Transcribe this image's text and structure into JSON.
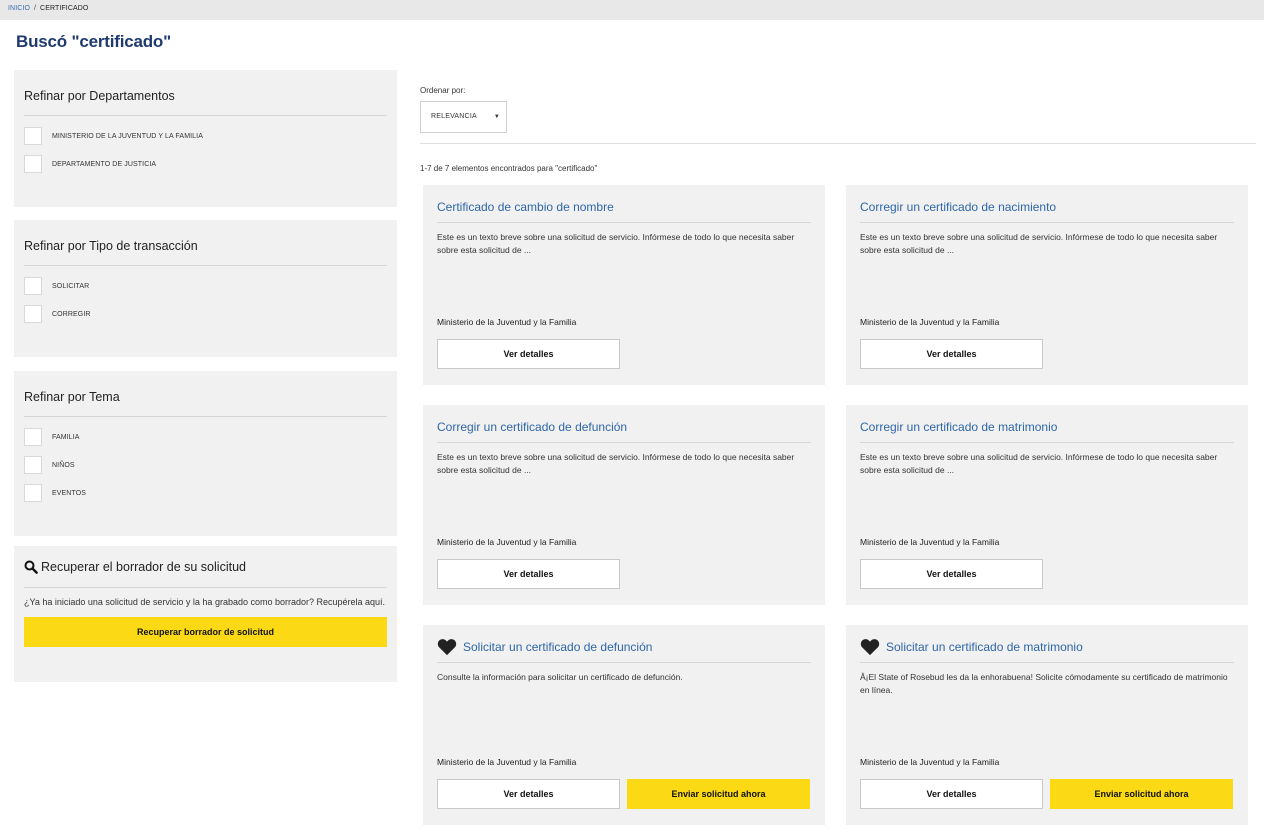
{
  "breadcrumb": {
    "home": "INICIO",
    "separator": "/",
    "current": "CERTIFICADO"
  },
  "page_title": "Buscó \"certificado\"",
  "filters": [
    {
      "title": "Refinar por Departamentos",
      "options": [
        "MINISTERIO DE LA JUVENTUD Y LA FAMILIA",
        "DEPARTAMENTO DE JUSTICIA"
      ]
    },
    {
      "title": "Refinar por Tipo de transacción",
      "options": [
        "SOLICITAR",
        "CORREGIR"
      ]
    },
    {
      "title": "Refinar por Tema",
      "options": [
        "FAMILIA",
        "NIÑOS",
        "EVENTOS"
      ]
    }
  ],
  "draft": {
    "title": "Recuperar el borrador de su solicitud",
    "text": "¿Ya ha iniciado una solicitud de servicio y la ha grabado como borrador? Recupérela aquí.",
    "button": "Recuperar borrador de solicitud"
  },
  "sort": {
    "label": "Ordenar por:",
    "value": "RELEVANCIA"
  },
  "results_count": "1-7 de 7 elementos encontrados para \"certificado\"",
  "cards": [
    {
      "title": "Certificado de cambio de nombre",
      "desc": "Este es un texto breve sobre una solicitud de servicio. Infórmese de todo lo que necesita saber sobre esta solicitud de ...",
      "dept": "Ministerio de la Juventud y la Familia",
      "details_label": "Ver detalles"
    },
    {
      "title": "Corregir un certificado de nacimiento",
      "desc": "Este es un texto breve sobre una solicitud de servicio. Infórmese de todo lo que necesita saber sobre esta solicitud de ...",
      "dept": "Ministerio de la Juventud y la Familia",
      "details_label": "Ver detalles"
    },
    {
      "title": "Corregir un certificado de defunción",
      "desc": "Este es un texto breve sobre una solicitud de servicio. Infórmese de todo lo que necesita saber sobre esta solicitud de ...",
      "dept": "Ministerio de la Juventud y la Familia",
      "details_label": "Ver detalles"
    },
    {
      "title": "Corregir un certificado de matrimonio",
      "desc": "Este es un texto breve sobre una solicitud de servicio. Infórmese de todo lo que necesita saber sobre esta solicitud de ...",
      "dept": "Ministerio de la Juventud y la Familia",
      "details_label": "Ver detalles"
    },
    {
      "title": "Solicitar un certificado de defunción",
      "desc": "Consulte la información para solicitar un certificado de defunción.",
      "dept": "Ministerio de la Juventud y la Familia",
      "details_label": "Ver detalles",
      "apply_label": "Enviar solicitud ahora",
      "icon": "heart-icon"
    },
    {
      "title": "Solicitar un certificado de matrimonio",
      "desc": "Â¡El State of Rosebud les da la enhorabuena! Solicite cómodamente su certificado de matrimonio en línea.",
      "dept": "Ministerio de la Juventud y la Familia",
      "details_label": "Ver detalles",
      "apply_label": "Enviar solicitud ahora",
      "icon": "heart-icon"
    }
  ],
  "colors": {
    "accent_yellow": "#fbd914",
    "link_blue": "#2e66a8",
    "title_navy": "#1e3a6e",
    "panel_gray": "#f1f1f1"
  }
}
